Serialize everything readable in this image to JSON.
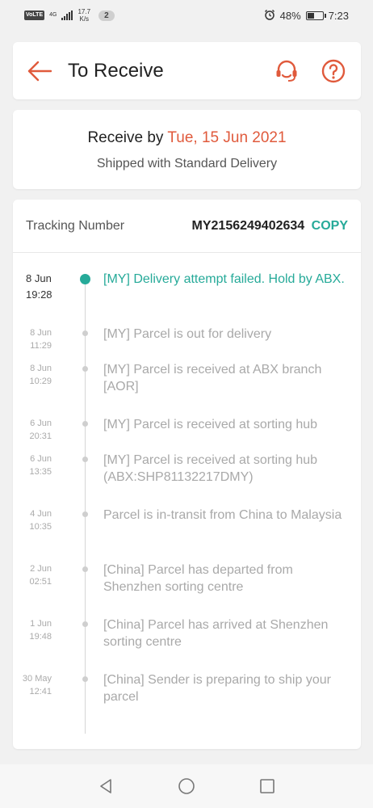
{
  "status_bar": {
    "volte": "VoLTE",
    "network": "4G",
    "speed_value": "17.7",
    "speed_unit": "K/s",
    "notification_count": "2",
    "battery": "48%",
    "time": "7:23"
  },
  "header": {
    "title": "To Receive",
    "icons": [
      "back-arrow-icon",
      "customer-support-icon",
      "help-icon"
    ],
    "accent_color": "#e05a3c"
  },
  "receive": {
    "prefix": "Receive by",
    "date": "Tue, 15 Jun 2021",
    "shipping": "Shipped with Standard Delivery"
  },
  "tracking": {
    "label": "Tracking Number",
    "number": "MY2156249402634",
    "copy_label": "COPY",
    "active_color": "#26aa99",
    "events": [
      {
        "date": "8 Jun",
        "time": "19:28",
        "desc": "[MY] Delivery attempt failed. Hold by ABX.",
        "active": true
      },
      {
        "date": "8 Jun",
        "time": "11:29",
        "desc": "[MY] Parcel is out for delivery"
      },
      {
        "date": "8 Jun",
        "time": "10:29",
        "desc": "[MY] Parcel is received at ABX branch [AOR]"
      },
      {
        "date": "6 Jun",
        "time": "20:31",
        "desc": "[MY] Parcel is received at sorting hub"
      },
      {
        "date": "6 Jun",
        "time": "13:35",
        "desc": "[MY] Parcel is received at sorting hub (ABX:SHP81132217DMY)"
      },
      {
        "date": "4 Jun",
        "time": "10:35",
        "desc": "Parcel is in-transit from China to Malaysia"
      },
      {
        "date": "2 Jun",
        "time": "02:51",
        "desc": "[China] Parcel has departed from Shenzhen sorting centre"
      },
      {
        "date": "1 Jun",
        "time": "19:48",
        "desc": "[China] Parcel has arrived at Shenzhen sorting centre"
      },
      {
        "date": "30 May",
        "time": "12:41",
        "desc": "[China] Sender is preparing to ship your parcel"
      }
    ]
  },
  "navbar": {
    "icons": [
      "back-triangle-icon",
      "home-circle-icon",
      "recents-square-icon"
    ]
  }
}
